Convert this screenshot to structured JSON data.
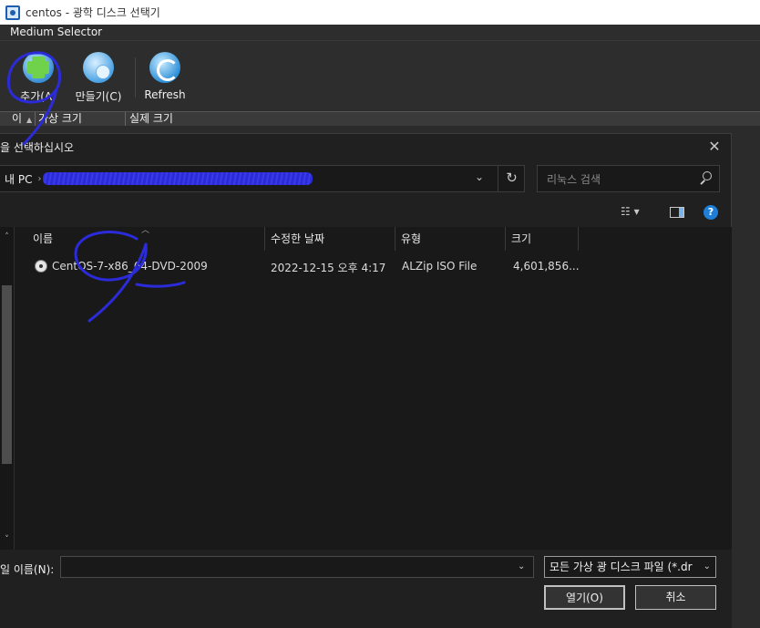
{
  "window": {
    "title": "centos - 광학 디스크 선택기"
  },
  "menubar": {
    "title": "Medium Selector",
    "title_underline_letter": "M"
  },
  "toolbar": {
    "add_label": "추가(A)",
    "create_label": "만들기(C)",
    "refresh_label": "Refresh"
  },
  "list_header": {
    "col_name": "이",
    "col_virtual_size": "가상 크기",
    "col_actual_size": "실제 크기"
  },
  "dialog": {
    "title": "을 선택하십시오",
    "close_glyph": "✕",
    "address": {
      "root": "내 PC",
      "path_redacted": true
    },
    "search_placeholder": "리눅스 검색",
    "help_glyph": "?",
    "columns": {
      "name": "이름",
      "modified": "수정한 날짜",
      "type": "유형",
      "size": "크기"
    },
    "files": [
      {
        "name": "CentOS-7-x86_64-DVD-2009",
        "modified": "2022-12-15 오후 4:17",
        "type": "ALZip ISO File",
        "size": "4,601,856..."
      }
    ],
    "filename_label": "일 이름(N):",
    "filename_value": "",
    "filter_value": "모든 가상 광 디스크 파일 (*.dr",
    "open_label": "열기(O)",
    "cancel_label": "취소"
  },
  "colors": {
    "annotation_ink": "#2b2bd9",
    "help_blue": "#1e7fd8",
    "dark_bg": "#202020"
  },
  "icons": [
    "app-vbox-icon",
    "add-disk-icon",
    "create-disk-icon",
    "refresh-icon",
    "close-icon",
    "chevron-right-icon",
    "dropdown-arrow-icon",
    "refresh-address-icon",
    "search-icon",
    "view-details-icon",
    "preview-pane-icon",
    "help-icon",
    "scroll-up-icon",
    "scroll-down-icon",
    "iso-file-icon"
  ]
}
